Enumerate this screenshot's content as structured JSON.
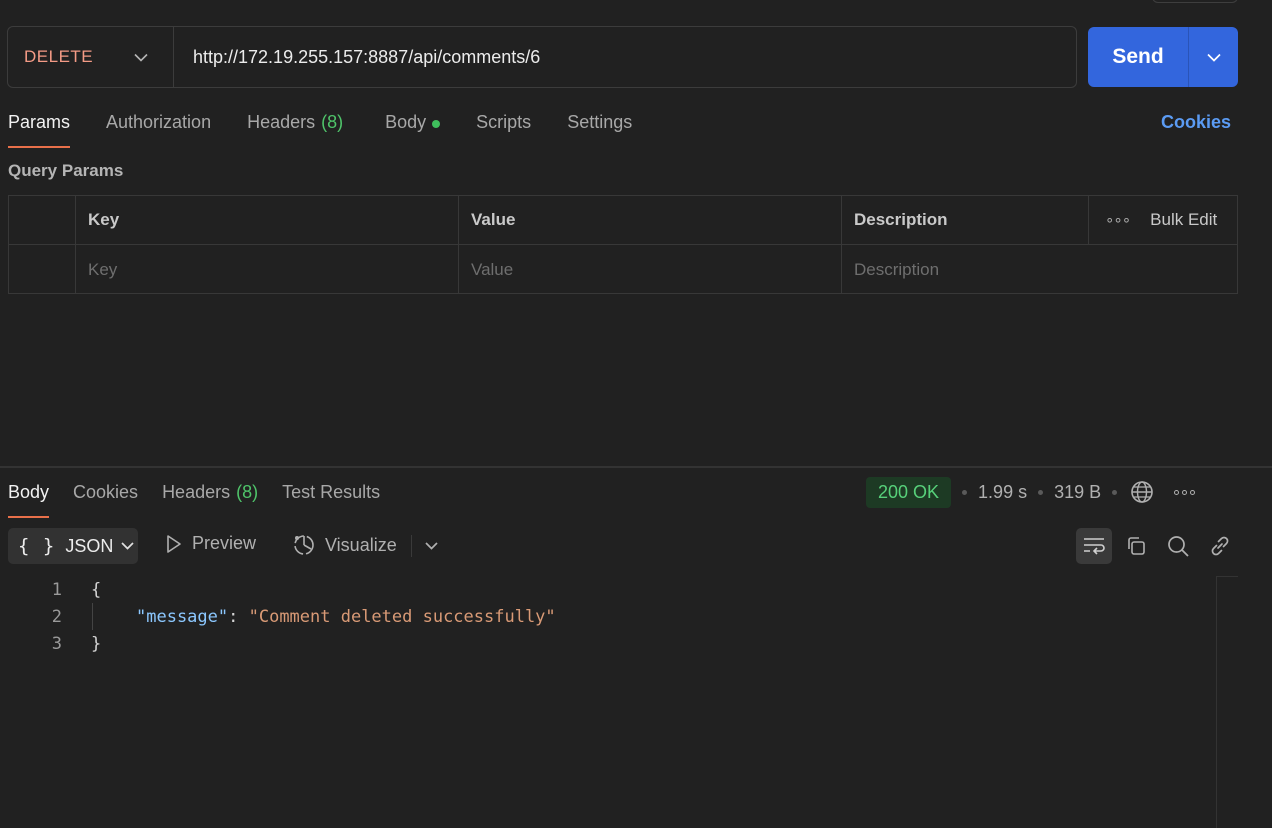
{
  "request": {
    "method": "DELETE",
    "url": "http://172.19.255.157:8887/api/comments/6",
    "send_label": "Send"
  },
  "request_tabs": [
    {
      "label": "Params",
      "active": true
    },
    {
      "label": "Authorization"
    },
    {
      "label": "Headers",
      "count": "(8)"
    },
    {
      "label": "Body",
      "has_dot": true
    },
    {
      "label": "Scripts"
    },
    {
      "label": "Settings"
    }
  ],
  "cookies_link": "Cookies",
  "query_params": {
    "title": "Query Params",
    "headers": {
      "key": "Key",
      "value": "Value",
      "description": "Description",
      "bulk_edit": "Bulk Edit"
    },
    "placeholders": {
      "key": "Key",
      "value": "Value",
      "description": "Description"
    }
  },
  "response_tabs": [
    {
      "label": "Body",
      "active": true
    },
    {
      "label": "Cookies"
    },
    {
      "label": "Headers",
      "count": "(8)"
    },
    {
      "label": "Test Results"
    }
  ],
  "response_meta": {
    "status": "200 OK",
    "time": "1.99 s",
    "size": "319 B"
  },
  "response_toolbar": {
    "format": "JSON",
    "preview": "Preview",
    "visualize": "Visualize"
  },
  "response_body": {
    "lines": [
      {
        "num": "1",
        "text": "{"
      },
      {
        "num": "2",
        "key": "\"message\"",
        "colon": ": ",
        "value": "\"Comment deleted successfully\""
      },
      {
        "num": "3",
        "text": "}"
      }
    ]
  },
  "colors": {
    "method_delete": "#f49b86",
    "send": "#3366dd",
    "active_tab_underline": "#e8704a",
    "status_ok": "#57d07a",
    "link": "#5b9bf3"
  }
}
